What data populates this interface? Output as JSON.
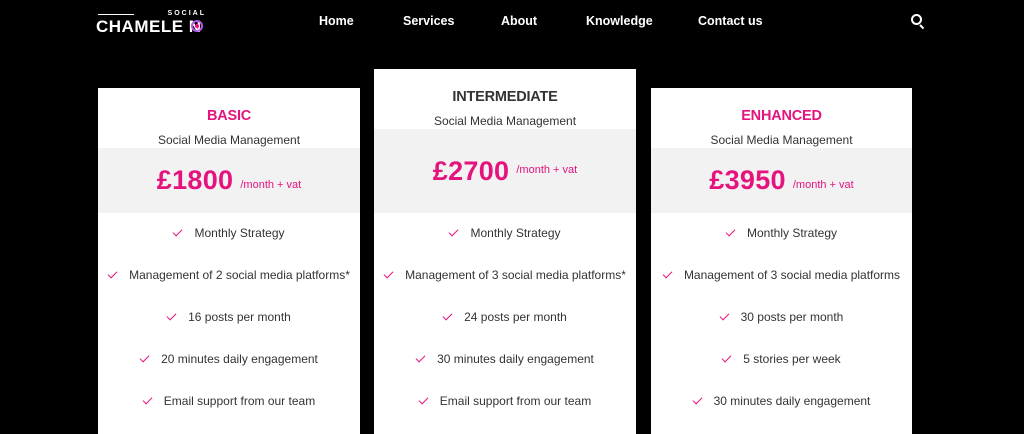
{
  "header": {
    "logo_small": "SOCIAL",
    "logo_main": "CHAMELE N",
    "nav": [
      "Home",
      "Services",
      "About",
      "Knowledge",
      "Contact us"
    ]
  },
  "plans": [
    {
      "name": "BASIC",
      "subtitle": "Social Media Management",
      "price": "£1800",
      "period": "/month + vat",
      "features": [
        "Monthly Strategy",
        "Management of 2 social media platforms*",
        "16 posts per month",
        "20 minutes daily engagement",
        "Email support from our team"
      ]
    },
    {
      "name": "INTERMEDIATE",
      "subtitle": "Social Media Management",
      "price": "£2700",
      "period": "/month + vat",
      "features": [
        "Monthly Strategy",
        "Management of 3 social media platforms*",
        "24 posts per month",
        "30 minutes daily engagement",
        "Email support from our team"
      ]
    },
    {
      "name": "ENHANCED",
      "subtitle": "Social Media Management",
      "price": "£3950",
      "period": "/month + vat",
      "features": [
        "Monthly Strategy",
        "Management of 3 social media platforms",
        "30 posts per month",
        "5 stories per week",
        "30 minutes daily engagement"
      ]
    }
  ],
  "colors": {
    "accent": "#e5137e",
    "background": "#000000",
    "card": "#ffffff",
    "price_band": "#f2f2f2"
  }
}
